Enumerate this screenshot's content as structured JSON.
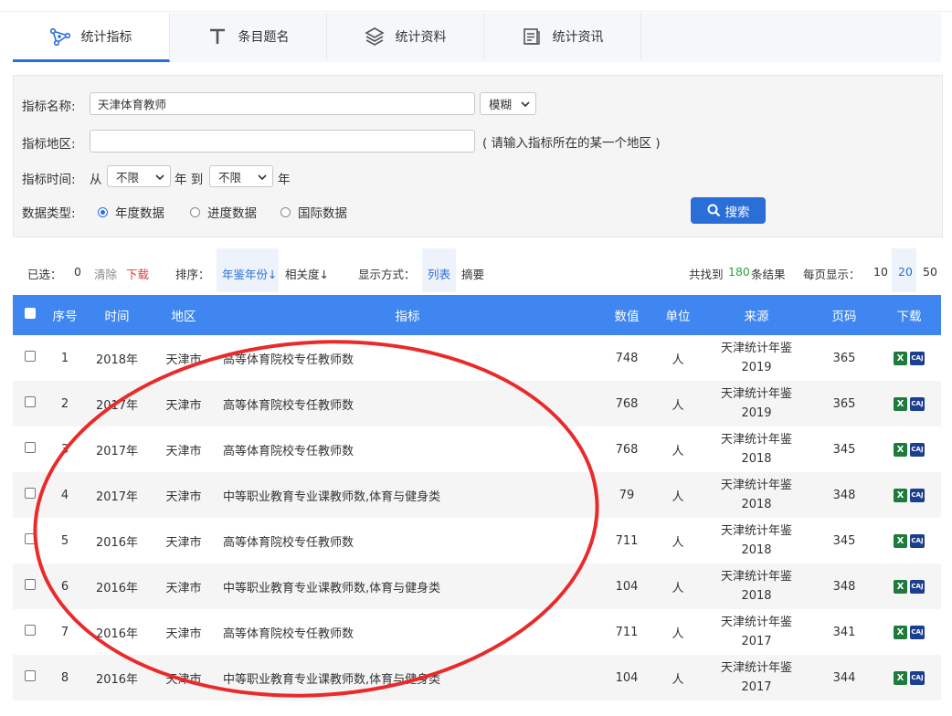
{
  "tabs": [
    {
      "label": "统计指标",
      "icon": "network-icon"
    },
    {
      "label": "条目题名",
      "icon": "text-t-icon"
    },
    {
      "label": "统计资料",
      "icon": "layers-icon"
    },
    {
      "label": "统计资讯",
      "icon": "document-list-icon"
    }
  ],
  "search": {
    "name_label": "指标名称:",
    "name_value": "天津体育教师",
    "match_mode": "模糊",
    "region_label": "指标地区:",
    "region_value": "",
    "region_hint": "( 请输入指标所在的某一个地区 )",
    "time_label": "指标时间:",
    "from_label": "从",
    "from_value": "不限",
    "year_label1": "年 到",
    "to_value": "不限",
    "year_label2": "年",
    "type_label": "数据类型:",
    "types": [
      "年度数据",
      "进度数据",
      "国际数据"
    ],
    "selected_type": "年度数据",
    "button_label": "搜索"
  },
  "toolbar": {
    "selected_label": "已选：",
    "selected_count": "0",
    "clear": "清除",
    "download": "下载",
    "sort_label": "排序：",
    "sort_year": "年鉴年份↓",
    "sort_relevance": "相关度↓",
    "display_label": "显示方式：",
    "display_list": "列表",
    "display_summary": "摘要",
    "found_prefix": "共找到",
    "found_count": "180",
    "found_suffix": "条结果",
    "per_page_label": "每页显示：",
    "per_page_options": [
      "10",
      "20",
      "50"
    ],
    "per_page_selected": "20"
  },
  "table": {
    "headers": [
      "序号",
      "时间",
      "地区",
      "指标",
      "数值",
      "单位",
      "来源",
      "页码",
      "下载"
    ],
    "rows": [
      {
        "no": "1",
        "time": "2018年",
        "region": "天津市",
        "indicator": "高等体育院校专任教师数",
        "value": "748",
        "unit": "人",
        "source1": "天津统计年鉴",
        "source2": "2019",
        "page": "365"
      },
      {
        "no": "2",
        "time": "2017年",
        "region": "天津市",
        "indicator": "高等体育院校专任教师数",
        "value": "768",
        "unit": "人",
        "source1": "天津统计年鉴",
        "source2": "2019",
        "page": "365"
      },
      {
        "no": "3",
        "time": "2017年",
        "region": "天津市",
        "indicator": "高等体育院校专任教师数",
        "value": "768",
        "unit": "人",
        "source1": "天津统计年鉴",
        "source2": "2018",
        "page": "345"
      },
      {
        "no": "4",
        "time": "2017年",
        "region": "天津市",
        "indicator": "中等职业教育专业课教师数,体育与健身类",
        "value": "79",
        "unit": "人",
        "source1": "天津统计年鉴",
        "source2": "2018",
        "page": "348"
      },
      {
        "no": "5",
        "time": "2016年",
        "region": "天津市",
        "indicator": "高等体育院校专任教师数",
        "value": "711",
        "unit": "人",
        "source1": "天津统计年鉴",
        "source2": "2018",
        "page": "345"
      },
      {
        "no": "6",
        "time": "2016年",
        "region": "天津市",
        "indicator": "中等职业教育专业课教师数,体育与健身类",
        "value": "104",
        "unit": "人",
        "source1": "天津统计年鉴",
        "source2": "2018",
        "page": "348"
      },
      {
        "no": "7",
        "time": "2016年",
        "region": "天津市",
        "indicator": "高等体育院校专任教师数",
        "value": "711",
        "unit": "人",
        "source1": "天津统计年鉴",
        "source2": "2017",
        "page": "341"
      },
      {
        "no": "8",
        "time": "2016年",
        "region": "天津市",
        "indicator": "中等职业教育专业课教师数,体育与健身类",
        "value": "104",
        "unit": "人",
        "source1": "天津统计年鉴",
        "source2": "2017",
        "page": "344"
      }
    ]
  },
  "colors": {
    "accent": "#2a6ed8",
    "header_bg": "#3f86f0",
    "count_green": "#2ba33c",
    "download_red": "#e03b3b",
    "annotation_red": "#ea2a2a"
  }
}
